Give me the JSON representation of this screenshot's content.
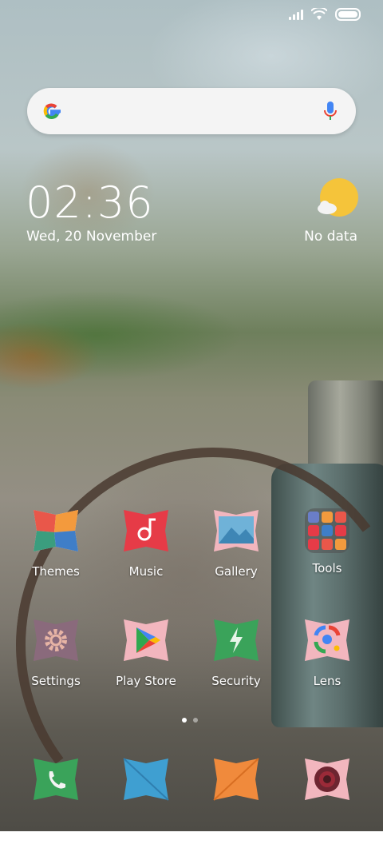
{
  "status_bar": {
    "signal_icon": "signal-icon",
    "wifi_icon": "wifi-icon",
    "battery_icon": "battery-icon"
  },
  "search": {
    "logo": "google-logo",
    "mic_icon": "mic-icon",
    "placeholder": ""
  },
  "clock": {
    "time": "02:36",
    "date": "Wed, 20 November"
  },
  "weather": {
    "icon": "weather-partly-cloudy-icon",
    "text": "No data"
  },
  "apps": [
    {
      "label": "Themes",
      "icon": "themes-icon"
    },
    {
      "label": "Music",
      "icon": "music-icon"
    },
    {
      "label": "Gallery",
      "icon": "gallery-icon"
    },
    {
      "label": "Tools",
      "icon": "tools-folder-icon"
    },
    {
      "label": "Settings",
      "icon": "settings-icon"
    },
    {
      "label": "Play Store",
      "icon": "play-store-icon"
    },
    {
      "label": "Security",
      "icon": "security-icon"
    },
    {
      "label": "Lens",
      "icon": "lens-icon"
    }
  ],
  "dock": [
    {
      "icon": "phone-icon"
    },
    {
      "icon": "messages-icon"
    },
    {
      "icon": "browser-icon"
    },
    {
      "icon": "camera-icon"
    }
  ],
  "page_indicator": {
    "pages": 2,
    "active": 1
  },
  "colors": {
    "themes": "#e9574a",
    "music": "#e63b47",
    "gallery": "#5aa1c6",
    "settings": "#8a6a7c",
    "play": "#f2b6be",
    "security": "#3aa35a",
    "lens": "#f2b6be",
    "phone": "#3aa35a",
    "messages": "#3f9fd1",
    "browser": "#f08a3c",
    "camera": "#f2b6be"
  }
}
